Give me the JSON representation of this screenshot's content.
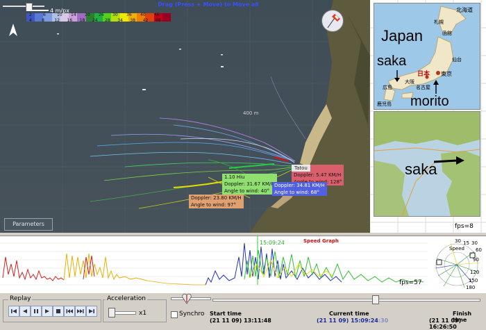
{
  "map": {
    "drag_hint": "Drag (Press + Move) to Move all",
    "scale_label": "4 m/px",
    "colorbar_top_labels": [
      "2",
      "6",
      "10",
      "14",
      "20",
      "26",
      "30",
      "36",
      "40",
      "46"
    ],
    "colorbar_bottom_labels": [
      "4",
      "8",
      "12",
      "16",
      "18",
      "24",
      "28",
      "34",
      "38",
      "42",
      "48"
    ],
    "colorbar_colors": [
      "#4055c0",
      "#5a78d6",
      "#7c9ae0",
      "#b0bfe6",
      "#d8c8e8",
      "#c8a0d8",
      "#9c6cc0",
      "#2a8030",
      "#1fb040",
      "#54d01c",
      "#b4e010",
      "#f0e800",
      "#f0b000",
      "#f08000",
      "#e04010",
      "#c00018",
      "#9a0020"
    ],
    "north_label": "N",
    "distance_label": "400 m",
    "parameters_button": "Parameters",
    "tags": {
      "tatou": [
        "Tatou",
        "Doppler: 5.47 KM/H",
        "Angle to wind: 128°"
      ],
      "hiu": [
        "1.10 Hiu",
        "Doppler: 31.67 KM/H",
        "Angle to wind: 40°"
      ],
      "doppler34": [
        "Doppler: 34.81 KM/H",
        "Angle to wind: 68°"
      ],
      "doppler23": [
        "Doppler: 23.80 KM/H",
        "Angle to wind: 97°"
      ]
    }
  },
  "right_panel": {
    "label_japan": "Japan",
    "label_saka_top": "saka",
    "label_morito": "morito",
    "label_saka_bottom": "saka",
    "jp_cities": [
      "北海道",
      "札幌",
      "函館",
      "仙台",
      "日本",
      "東京",
      "広島",
      "大阪",
      "名古屋",
      "鹿児島"
    ],
    "fps": "fps=8"
  },
  "graph": {
    "title": "Speed Graph",
    "cursor_time": "15:09:24",
    "fps": "fps=57",
    "mini_label": "Speed",
    "mini_ticks": [
      "30",
      "15",
      "30",
      "60",
      "90",
      "120",
      "150",
      "180"
    ]
  },
  "controls": {
    "replay_title": "Replay",
    "acceleration_title": "Acceleration",
    "acceleration_value": "x1",
    "synchro_label": "Synchro",
    "start_label": "Start time",
    "start_value": "(21 11 09) 13:11:48",
    "current_label": "Current time",
    "current_value": "(21 11 09) 15:09:24",
    "current_suffix": ":30",
    "finish_label": "Finish time",
    "finish_value": "(21 11 09) 16:26:50"
  }
}
